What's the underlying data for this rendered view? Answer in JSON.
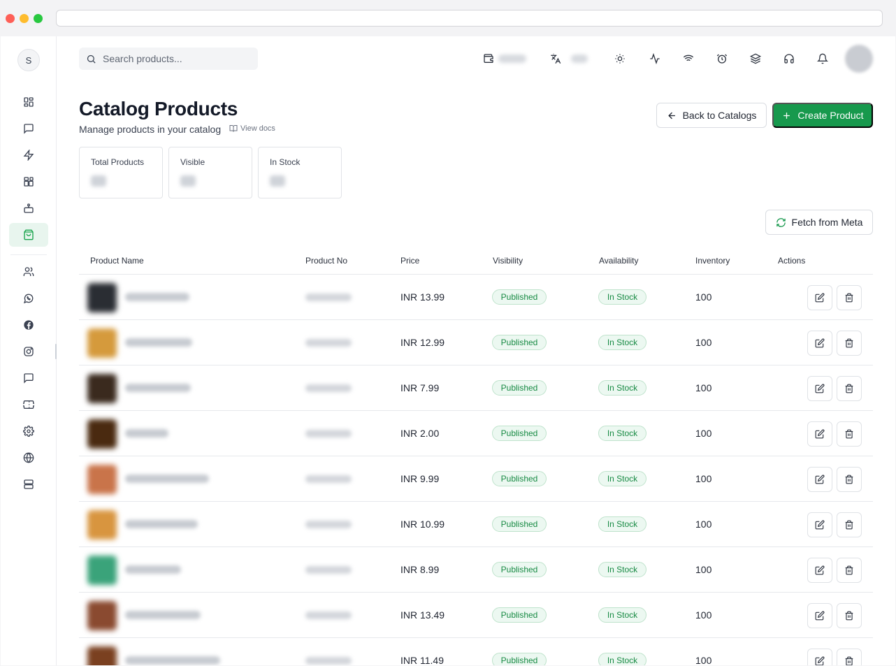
{
  "search": {
    "placeholder": "Search products..."
  },
  "header": {
    "title": "Catalog Products",
    "subtitle": "Manage products in your catalog",
    "docs_label": "View docs",
    "back_label": "Back to Catalogs",
    "create_label": "Create Product"
  },
  "stats": [
    {
      "label": "Total Products"
    },
    {
      "label": "Visible"
    },
    {
      "label": "In Stock"
    }
  ],
  "fetch_label": "Fetch from Meta",
  "columns": [
    "Product Name",
    "Product No",
    "Price",
    "Visibility",
    "Availability",
    "Inventory",
    "Actions"
  ],
  "rows": [
    {
      "price": "INR 13.99",
      "visibility": "Published",
      "availability": "In Stock",
      "inventory": "100"
    },
    {
      "price": "INR 12.99",
      "visibility": "Published",
      "availability": "In Stock",
      "inventory": "100"
    },
    {
      "price": "INR 7.99",
      "visibility": "Published",
      "availability": "In Stock",
      "inventory": "100"
    },
    {
      "price": "INR 2.00",
      "visibility": "Published",
      "availability": "In Stock",
      "inventory": "100"
    },
    {
      "price": "INR 9.99",
      "visibility": "Published",
      "availability": "In Stock",
      "inventory": "100"
    },
    {
      "price": "INR 10.99",
      "visibility": "Published",
      "availability": "In Stock",
      "inventory": "100"
    },
    {
      "price": "INR 8.99",
      "visibility": "Published",
      "availability": "In Stock",
      "inventory": "100"
    },
    {
      "price": "INR 13.49",
      "visibility": "Published",
      "availability": "In Stock",
      "inventory": "100"
    },
    {
      "price": "INR 11.49",
      "visibility": "Published",
      "availability": "In Stock",
      "inventory": "100"
    }
  ],
  "user": {
    "initial": "S"
  },
  "colors": {
    "accent": "#17994d",
    "badge_bg": "#ecf8f1",
    "badge_text": "#178a43"
  },
  "icons": {
    "sidebar": [
      "dashboard-icon",
      "chat-icon",
      "bolt-icon",
      "apps-icon",
      "bot-icon",
      "catalog-bag-icon",
      "users-icon",
      "whatsapp-icon",
      "facebook-icon",
      "instagram-icon",
      "message-icon",
      "ticket-icon",
      "settings-icon",
      "globe-icon",
      "server-icon"
    ],
    "topbar": [
      "wallet-icon",
      "translate-icon",
      "sun-icon",
      "activity-icon",
      "wifi-icon",
      "alarm-icon",
      "layers-icon",
      "headset-icon",
      "bell-icon"
    ]
  }
}
